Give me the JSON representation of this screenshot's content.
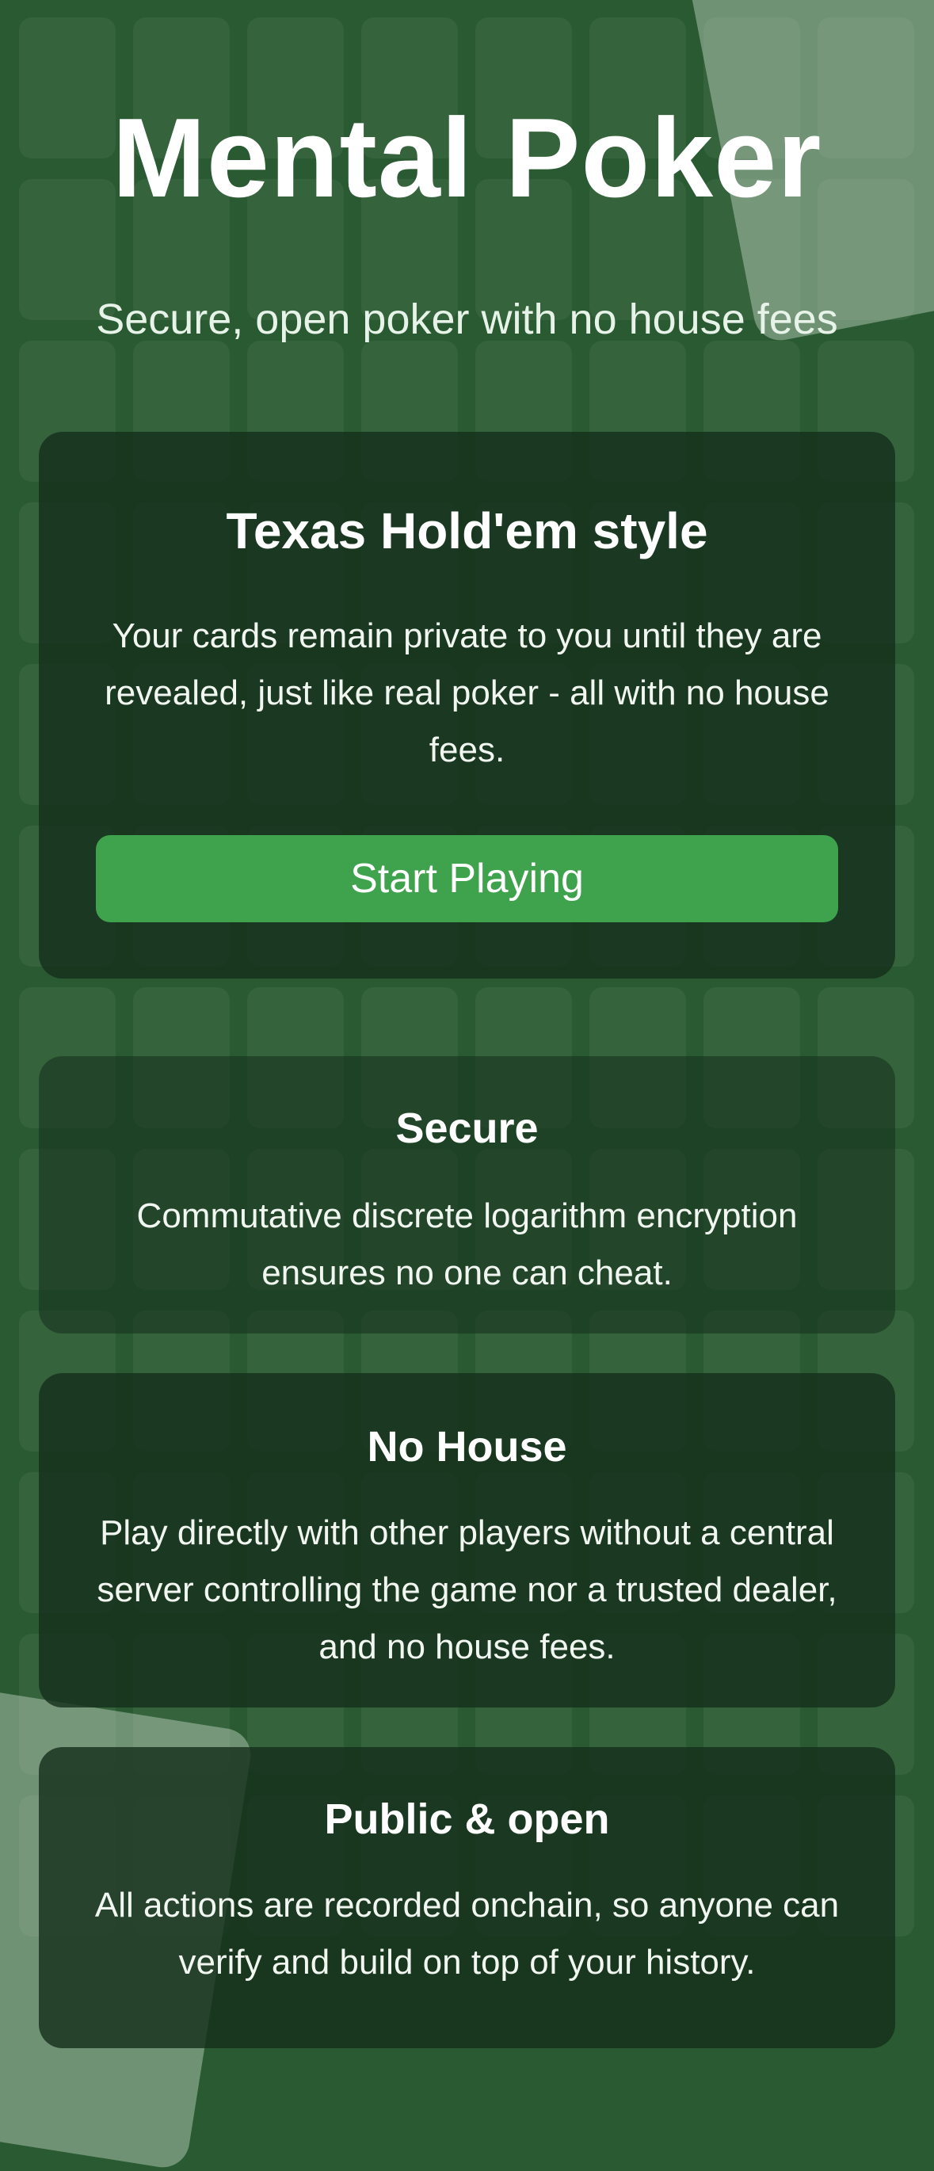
{
  "hero": {
    "title": "Mental Poker",
    "subtitle": "Secure, open poker with no house fees"
  },
  "main_card": {
    "title": "Texas Hold'em style",
    "description": "Your cards remain private to you until they are revealed, just like real poker - all with no house fees.",
    "button_label": "Start Playing"
  },
  "features": [
    {
      "title": "Secure",
      "description": "Commutative discrete logarithm encryption ensures no one can cheat."
    },
    {
      "title": "No House",
      "description": "Play directly with other players without a central server controlling the game nor a trusted dealer, and no house fees."
    },
    {
      "title": "Public & open",
      "description": "All actions are recorded onchain, so anyone can verify and build on top of your history."
    }
  ],
  "colors": {
    "background": "#295a31",
    "panel": "#16301c",
    "button": "#3fa34d",
    "text": "#ffffff"
  }
}
